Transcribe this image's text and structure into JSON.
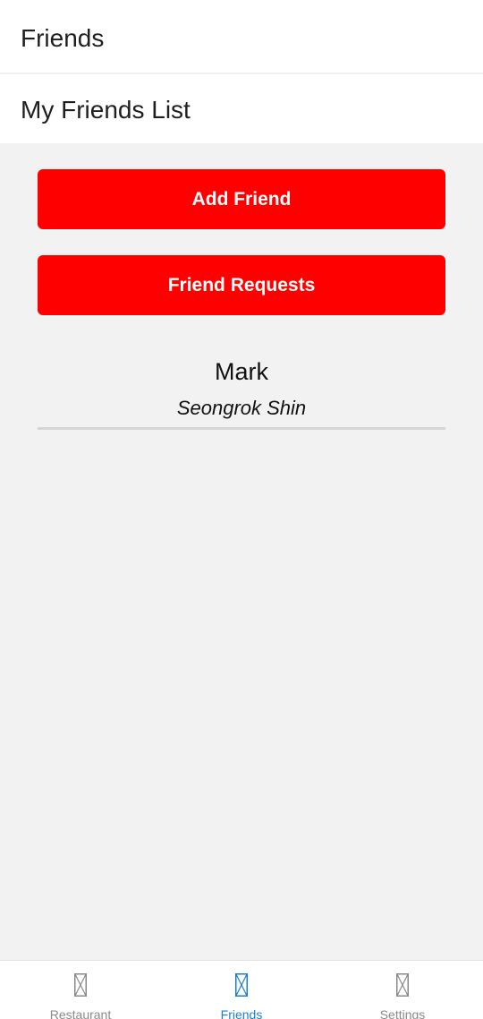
{
  "header": {
    "title": "Friends"
  },
  "section": {
    "title": "My Friends List"
  },
  "actions": {
    "add_friend_label": "Add Friend",
    "friend_requests_label": "Friend Requests",
    "button_color": "#ff0000"
  },
  "friends": [
    {
      "nickname": "Mark",
      "full_name": "Seongrok Shin"
    }
  ],
  "tabs": [
    {
      "label": "Restaurant",
      "icon": "placeholder-icon",
      "active": false
    },
    {
      "label": "Friends",
      "icon": "placeholder-icon",
      "active": true
    },
    {
      "label": "Settings",
      "icon": "placeholder-icon",
      "active": false
    }
  ],
  "colors": {
    "tab_active": "#1a7fd0",
    "tab_inactive": "#8a8a8a"
  }
}
